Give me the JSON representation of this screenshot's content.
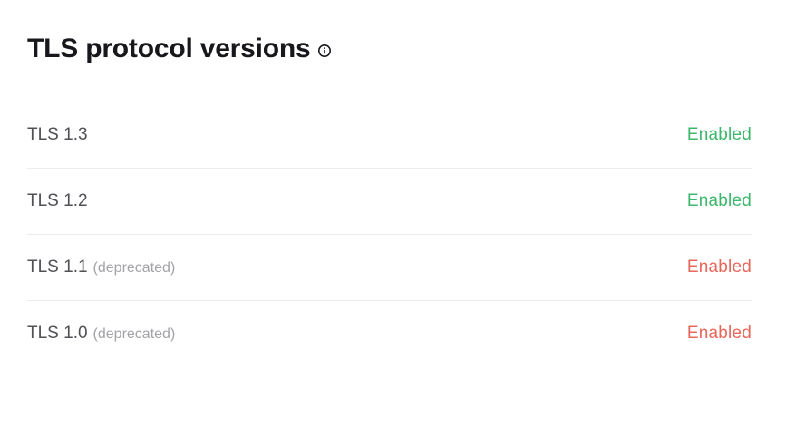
{
  "section": {
    "title": "TLS protocol versions",
    "info_icon": "info-circle-icon"
  },
  "colors": {
    "enabled_ok": "#3db86b",
    "enabled_warn": "#e8675b"
  },
  "protocols": [
    {
      "name": "TLS 1.3",
      "note": "",
      "status": "Enabled",
      "tone": "ok"
    },
    {
      "name": "TLS 1.2",
      "note": "",
      "status": "Enabled",
      "tone": "ok"
    },
    {
      "name": "TLS 1.1",
      "note": "(deprecated)",
      "status": "Enabled",
      "tone": "warn"
    },
    {
      "name": "TLS 1.0",
      "note": "(deprecated)",
      "status": "Enabled",
      "tone": "warn"
    }
  ]
}
